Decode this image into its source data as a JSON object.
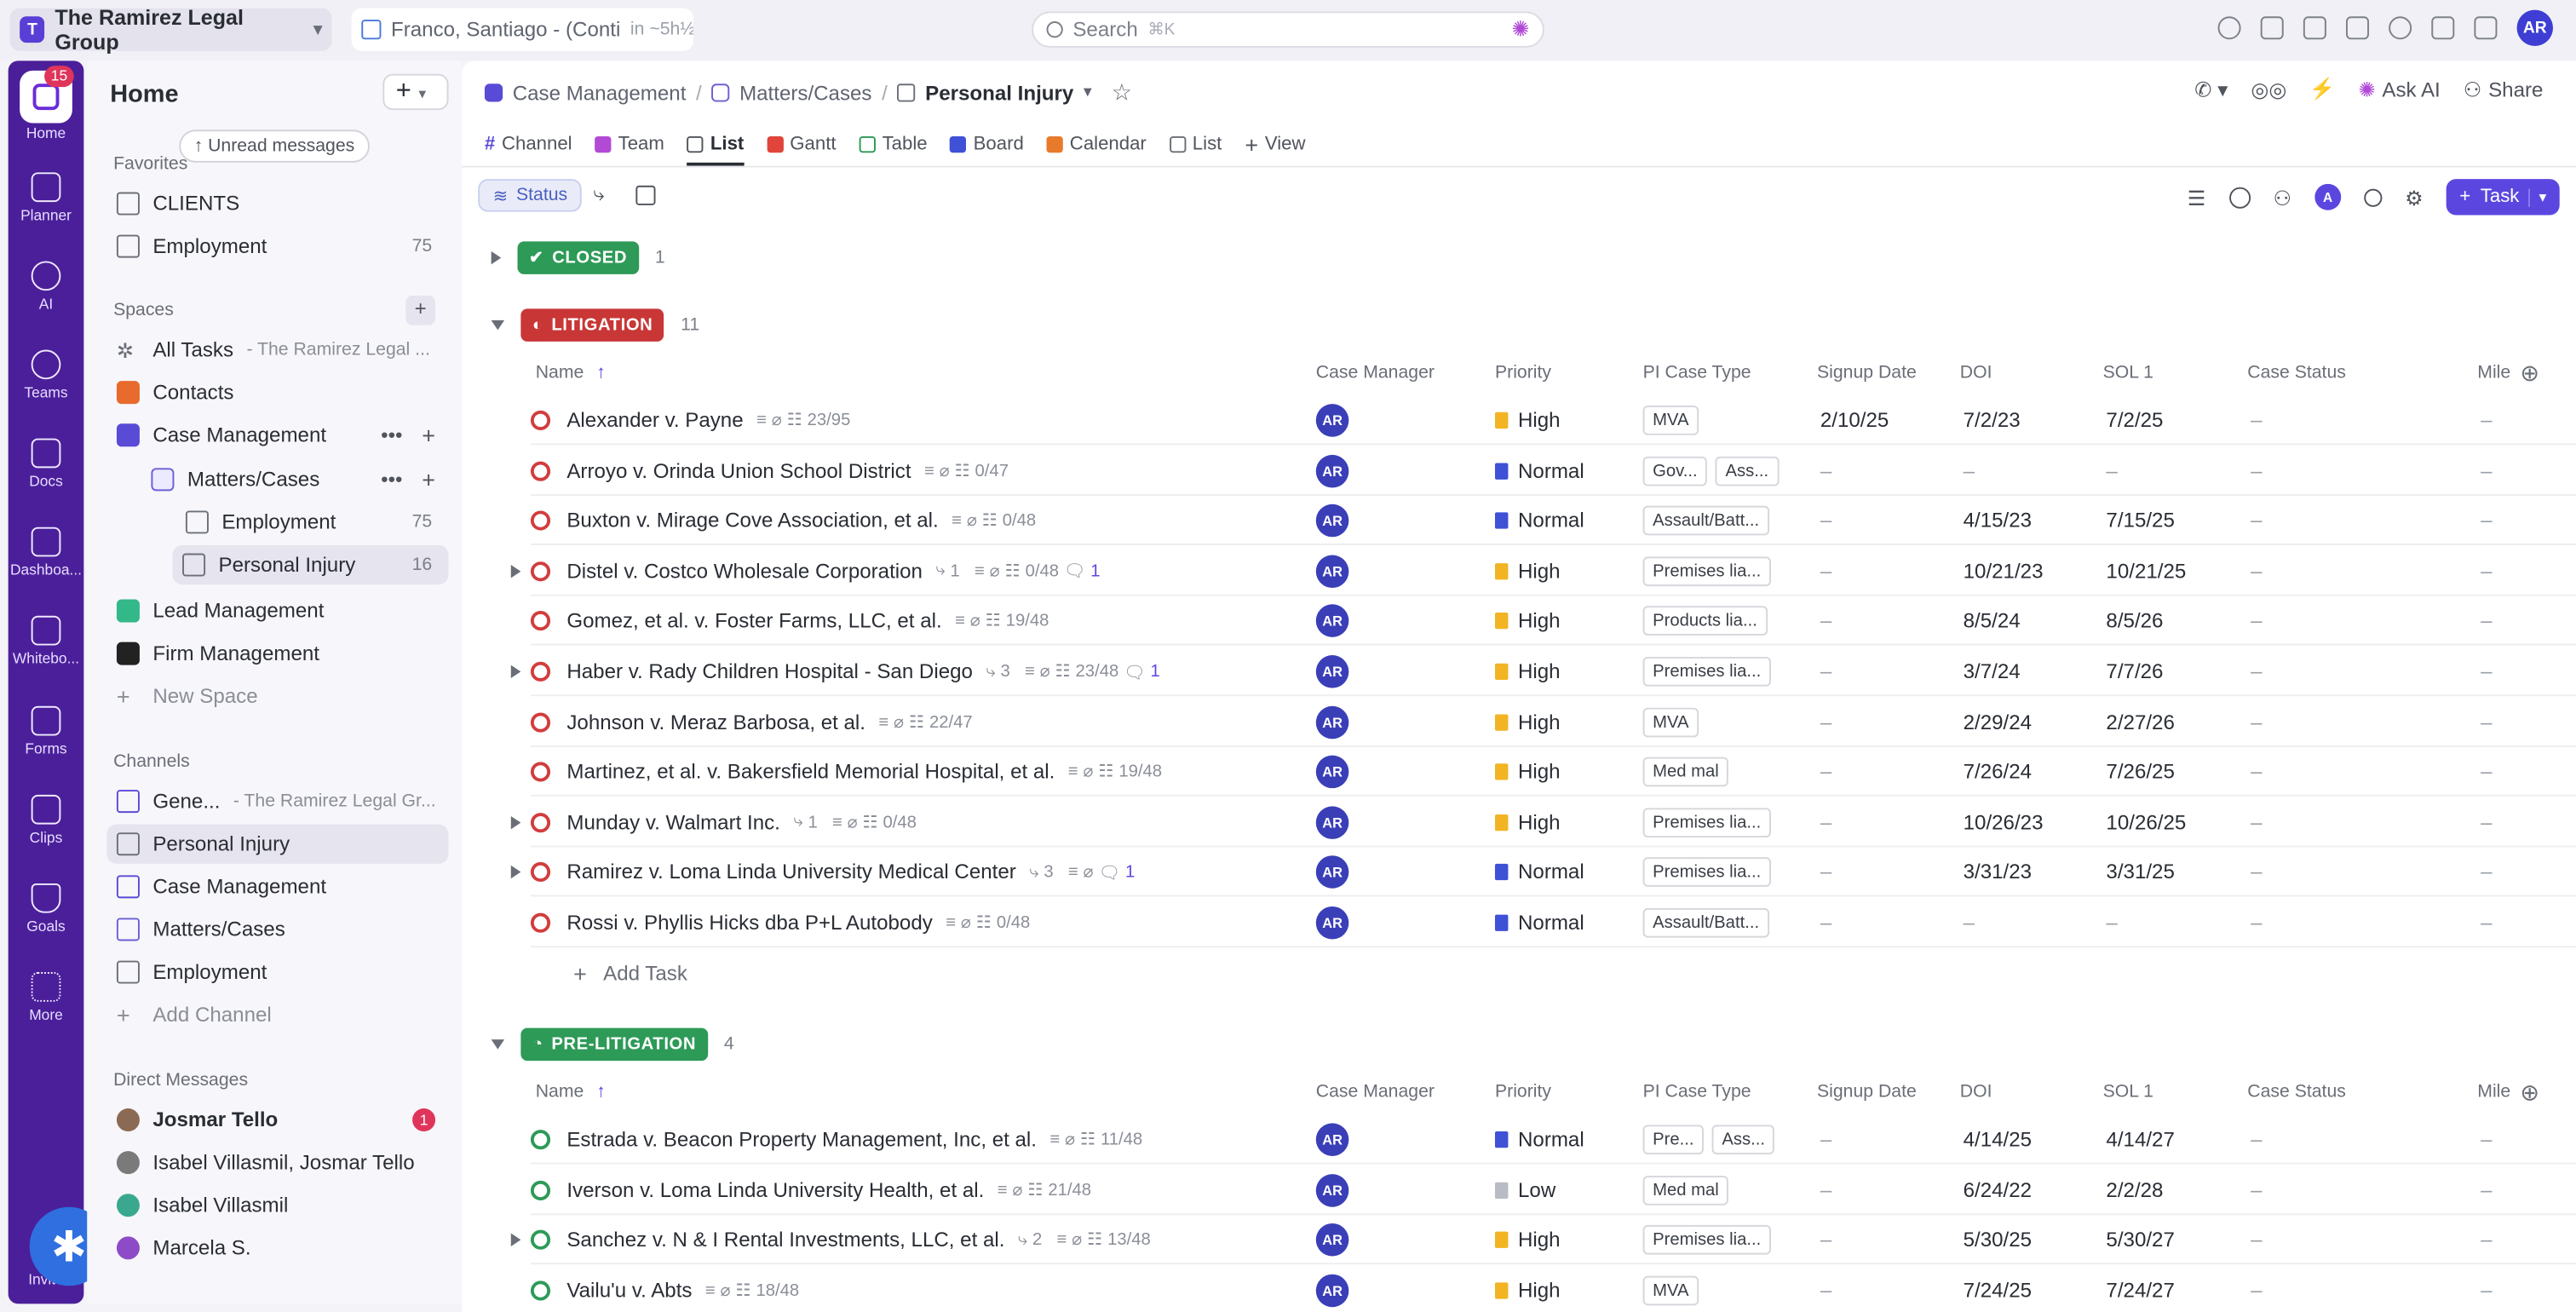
{
  "topbar": {
    "workspace": "The Ramirez Legal Group",
    "workspace_initial": "T",
    "crumb": "Franco, Santiago - (Conti",
    "crumb_dim": "in ~5h½",
    "search_placeholder": "Search",
    "search_kbd": "⌘K",
    "user_initials": "AR"
  },
  "rail": {
    "badge": "15",
    "items": [
      "Home",
      "Planner",
      "AI",
      "Teams",
      "Docs",
      "Dashboa...",
      "Whitebo...",
      "Forms",
      "Clips",
      "Goals",
      "More"
    ],
    "invite": "Invite"
  },
  "sidebar": {
    "title": "Home",
    "unread": "↑ Unread messages",
    "favorites_label": "Favorites",
    "favorites": [
      {
        "label": "CLIENTS",
        "count": ""
      },
      {
        "label": "Employment",
        "count": "75"
      }
    ],
    "spaces_label": "Spaces",
    "spaces": [
      {
        "label": "All Tasks",
        "sub": "- The Ramirez Legal ..."
      },
      {
        "label": "Contacts"
      },
      {
        "label": "Case Management"
      },
      {
        "label": "Matters/Cases"
      },
      {
        "label": "Employment",
        "count": "75"
      },
      {
        "label": "Personal Injury",
        "count": "16"
      },
      {
        "label": "Lead Management"
      },
      {
        "label": "Firm Management"
      },
      {
        "label": "New Space"
      }
    ],
    "channels_label": "Channels",
    "channels": [
      {
        "label": "Gene...",
        "sub": "- The Ramirez Legal Gr..."
      },
      {
        "label": "Personal Injury"
      },
      {
        "label": "Case Management"
      },
      {
        "label": "Matters/Cases"
      },
      {
        "label": "Employment"
      },
      {
        "label": "Add Channel"
      }
    ],
    "dm_label": "Direct Messages",
    "dms": [
      {
        "label": "Josmar Tello",
        "badge": "1"
      },
      {
        "label": "Isabel Villasmil, Josmar Tello"
      },
      {
        "label": "Isabel Villasmil"
      },
      {
        "label": "Marcela S."
      }
    ]
  },
  "main": {
    "breadcrumb": [
      "Case Management",
      "Matters/Cases",
      "Personal Injury"
    ],
    "ask_ai": "Ask AI",
    "share": "Share",
    "views": [
      "Channel",
      "Team",
      "List",
      "Gantt",
      "Table",
      "Board",
      "Calendar",
      "List",
      "View"
    ],
    "status_pill": "Status",
    "task_button": "Task",
    "columns": [
      "Name",
      "Case Manager",
      "Priority",
      "PI Case Type",
      "Signup Date",
      "DOI",
      "SOL 1",
      "Case Status",
      "Mile"
    ],
    "groups": [
      {
        "label": "CLOSED",
        "count": "1",
        "color": "#2d9a57"
      },
      {
        "label": "LITIGATION",
        "count": "11",
        "color": "#c93636"
      },
      {
        "label": "PRE-LITIGATION",
        "count": "4",
        "color": "#2d9a57"
      }
    ],
    "add_task": "Add Task",
    "litigation_rows": [
      {
        "name": "Alexander v. Payne",
        "meta": "23/95",
        "priority": "High",
        "types": [
          "MVA"
        ],
        "signup": "2/10/25",
        "doi": "7/2/23",
        "sol": "7/2/25",
        "status": "–",
        "mile": "–"
      },
      {
        "name": "Arroyo v. Orinda Union School District",
        "meta": "0/47",
        "priority": "Normal",
        "types": [
          "Gov...",
          "Ass..."
        ],
        "signup": "–",
        "doi": "–",
        "sol": "–",
        "status": "–",
        "mile": "–"
      },
      {
        "name": "Buxton v. Mirage Cove Association, et al.",
        "meta": "0/48",
        "priority": "Normal",
        "types": [
          "Assault/Batt..."
        ],
        "signup": "–",
        "doi": "4/15/23",
        "sol": "7/15/25",
        "status": "–",
        "mile": "–"
      },
      {
        "name": "Distel v. Costco Wholesale Corporation",
        "meta": "0/48",
        "sub": "1",
        "comments": "1",
        "priority": "High",
        "types": [
          "Premises lia..."
        ],
        "signup": "–",
        "doi": "10/21/23",
        "sol": "10/21/25",
        "status": "–",
        "mile": "–"
      },
      {
        "name": "Gomez, et al. v. Foster Farms, LLC, et al.",
        "meta": "19/48",
        "priority": "High",
        "types": [
          "Products lia..."
        ],
        "signup": "–",
        "doi": "8/5/24",
        "sol": "8/5/26",
        "status": "–",
        "mile": "–"
      },
      {
        "name": "Haber v. Rady Children Hospital - San Diego",
        "meta": "23/48",
        "sub": "3",
        "comments": "1",
        "priority": "High",
        "types": [
          "Premises lia..."
        ],
        "signup": "–",
        "doi": "3/7/24",
        "sol": "7/7/26",
        "status": "–",
        "mile": "–"
      },
      {
        "name": "Johnson v. Meraz Barbosa, et al.",
        "meta": "22/47",
        "priority": "High",
        "types": [
          "MVA"
        ],
        "signup": "–",
        "doi": "2/29/24",
        "sol": "2/27/26",
        "status": "–",
        "mile": "–"
      },
      {
        "name": "Martinez, et al. v. Bakersfield Memorial Hospital, et al.",
        "meta": "19/48",
        "priority": "High",
        "types": [
          "Med mal"
        ],
        "signup": "–",
        "doi": "7/26/24",
        "sol": "7/26/25",
        "status": "–",
        "mile": "–"
      },
      {
        "name": "Munday v. Walmart Inc.",
        "meta": "0/48",
        "sub": "1",
        "priority": "High",
        "types": [
          "Premises lia..."
        ],
        "signup": "–",
        "doi": "10/26/23",
        "sol": "10/26/25",
        "status": "–",
        "mile": "–"
      },
      {
        "name": "Ramirez v. Loma Linda University Medical Center",
        "meta": "",
        "sub": "3",
        "comments": "1",
        "priority": "Normal",
        "types": [
          "Premises lia..."
        ],
        "signup": "–",
        "doi": "3/31/23",
        "sol": "3/31/25",
        "status": "–",
        "mile": "–"
      },
      {
        "name": "Rossi v. Phyllis Hicks dba P+L Autobody",
        "meta": "0/48",
        "priority": "Normal",
        "types": [
          "Assault/Batt..."
        ],
        "signup": "–",
        "doi": "–",
        "sol": "–",
        "status": "–",
        "mile": "–"
      }
    ],
    "prelit_rows": [
      {
        "name": "Estrada v. Beacon Property Management, Inc, et al.",
        "meta": "11/48",
        "priority": "Normal",
        "types": [
          "Pre...",
          "Ass..."
        ],
        "signup": "–",
        "doi": "4/14/25",
        "sol": "4/14/27",
        "status": "–",
        "mile": "–"
      },
      {
        "name": "Iverson v. Loma Linda University Health, et al.",
        "meta": "21/48",
        "priority": "Low",
        "types": [
          "Med mal"
        ],
        "signup": "–",
        "doi": "6/24/22",
        "sol": "2/2/28",
        "status": "–",
        "mile": "–"
      },
      {
        "name": "Sanchez v. N & I Rental Investments, LLC, et al.",
        "meta": "13/48",
        "sub": "2",
        "priority": "High",
        "types": [
          "Premises lia..."
        ],
        "signup": "–",
        "doi": "5/30/25",
        "sol": "5/30/27",
        "status": "–",
        "mile": "–"
      },
      {
        "name": "Vailu'u v. Abts",
        "meta": "18/48",
        "priority": "High",
        "types": [
          "MVA"
        ],
        "signup": "–",
        "doi": "7/24/25",
        "sol": "7/24/27",
        "status": "–",
        "mile": "–"
      }
    ],
    "manager": "AR"
  },
  "colors": {
    "high": "#f2b423",
    "normal": "#3f51d6",
    "low": "#b9bcc4",
    "accent": "#5b47e0",
    "rail": "#4b1f9a"
  }
}
